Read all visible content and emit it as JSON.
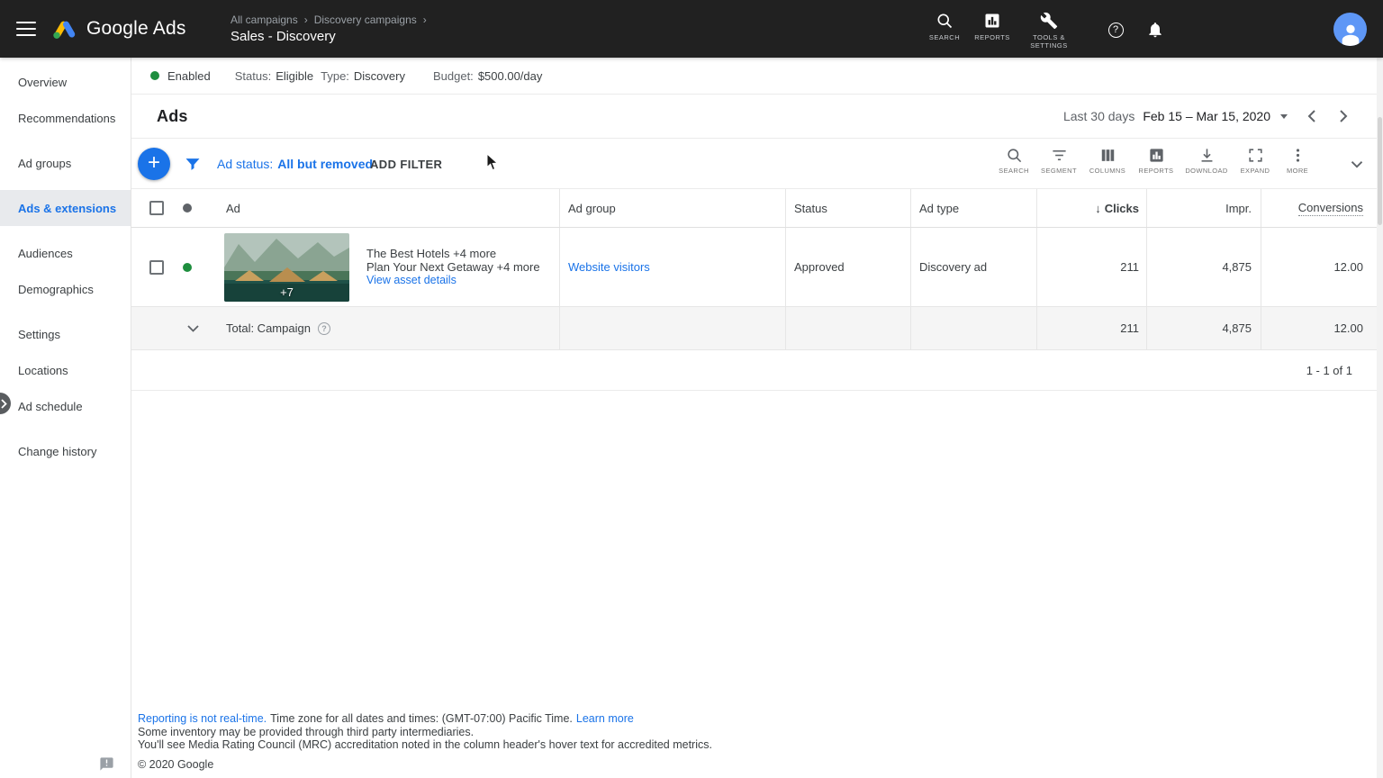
{
  "colors": {
    "topbar_bg": "#212121",
    "accent_blue": "#1a73e8",
    "enabled_green": "#1e8e3e"
  },
  "icons": {
    "chevron_right": "›",
    "plus": "+",
    "question": "?",
    "sort_desc": "↓"
  },
  "topbar": {
    "brand": "Google Ads",
    "breadcrumbs": [
      "All campaigns",
      "Discovery campaigns"
    ],
    "campaign_title": "Sales - Discovery",
    "search_label": "SEARCH",
    "reports_label": "REPORTS",
    "tools_label": "TOOLS & SETTINGS"
  },
  "sidebar": {
    "active_item": "Ads & extensions",
    "items": [
      {
        "label": "Overview"
      },
      {
        "label": "Recommendations"
      },
      {
        "label": "Ad groups"
      },
      {
        "label": "Ads & extensions"
      },
      {
        "label": "Audiences"
      },
      {
        "label": "Demographics"
      },
      {
        "label": "Settings"
      },
      {
        "label": "Locations"
      },
      {
        "label": "Ad schedule"
      },
      {
        "label": "Change history"
      }
    ]
  },
  "campaign_status": {
    "state": "Enabled",
    "status_label": "Status:",
    "status_value": "Eligible",
    "type_label": "Type:",
    "type_value": "Discovery",
    "budget_label": "Budget:",
    "budget_value": "$500.00/day"
  },
  "page_header": {
    "title": "Ads",
    "date_preset": "Last 30 days",
    "date_range": "Feb 15 – Mar 15, 2020"
  },
  "toolbar": {
    "filter_label": "Ad status:",
    "filter_value": "All but removed",
    "add_filter": "ADD FILTER",
    "tools": [
      {
        "label": "SEARCH"
      },
      {
        "label": "SEGMENT"
      },
      {
        "label": "COLUMNS"
      },
      {
        "label": "REPORTS"
      },
      {
        "label": "DOWNLOAD"
      },
      {
        "label": "EXPAND"
      },
      {
        "label": "MORE"
      }
    ]
  },
  "table": {
    "headers": {
      "ad": "Ad",
      "ad_group": "Ad group",
      "status": "Status",
      "ad_type": "Ad type",
      "clicks": "Clicks",
      "impressions": "Impr.",
      "conversions": "Conversions"
    },
    "sort_column": "Clicks",
    "rows": [
      {
        "thumb_more": "+7",
        "title": "The Best Hotels +4 more",
        "subtitle": "Plan Your Next Getaway +4 more",
        "asset_link": "View asset details",
        "ad_group": "Website visitors",
        "status": "Approved",
        "ad_type": "Discovery ad",
        "clicks": "211",
        "impressions": "4,875",
        "conversions": "12.00"
      }
    ],
    "total": {
      "label": "Total: Campaign",
      "clicks": "211",
      "impressions": "4,875",
      "conversions": "12.00"
    },
    "pagination": "1 - 1 of 1"
  },
  "footer": {
    "reporting_link": "Reporting is not real-time.",
    "timezone_text": "Time zone for all dates and times: (GMT-07:00) Pacific Time.",
    "learn_more": "Learn more",
    "inventory_text": "Some inventory may be provided through third party intermediaries.",
    "mrc_text": "You'll see Media Rating Council (MRC) accreditation noted in the column header's hover text for accredited metrics.",
    "copyright": "© 2020 Google"
  }
}
